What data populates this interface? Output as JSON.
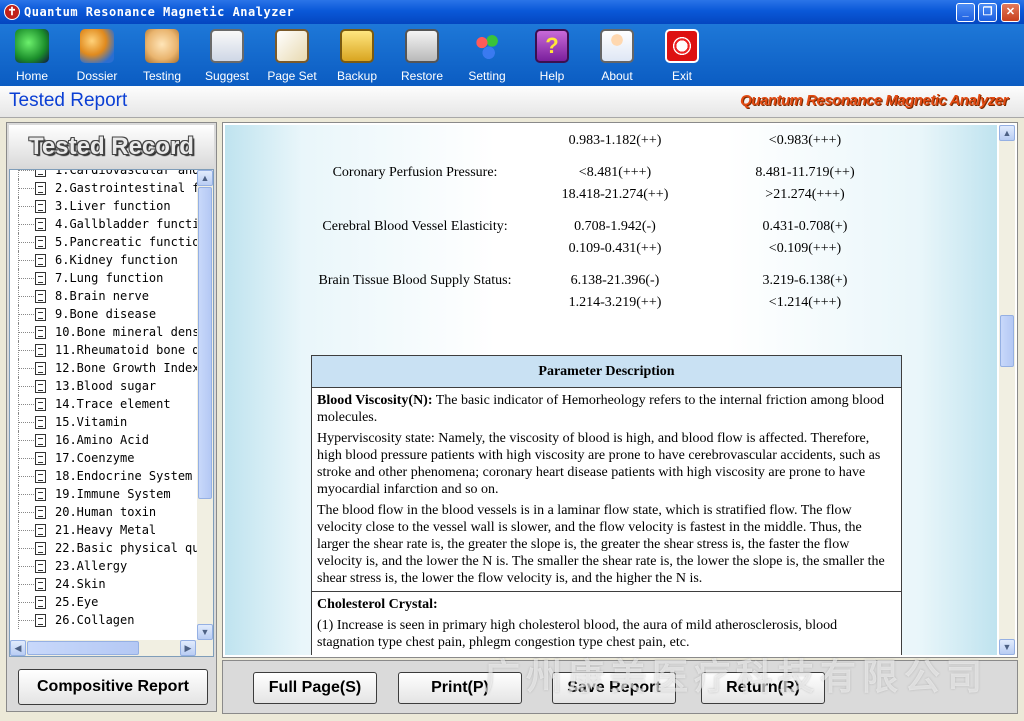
{
  "window": {
    "title": "Quantum Resonance Magnetic Analyzer"
  },
  "toolbar": [
    {
      "label": "Home",
      "icon": "home-icon"
    },
    {
      "label": "Dossier",
      "icon": "users-icon"
    },
    {
      "label": "Testing",
      "icon": "hand-icon"
    },
    {
      "label": "Suggest",
      "icon": "clipboard-icon"
    },
    {
      "label": "Page Set",
      "icon": "page-icon"
    },
    {
      "label": "Backup",
      "icon": "backup-icon"
    },
    {
      "label": "Restore",
      "icon": "restore-icon"
    },
    {
      "label": "Setting",
      "icon": "gears-icon"
    },
    {
      "label": "Help",
      "icon": "help-icon"
    },
    {
      "label": "About",
      "icon": "about-icon"
    },
    {
      "label": "Exit",
      "icon": "power-icon"
    }
  ],
  "header": {
    "title": "Tested Report",
    "brand": "Quantum Resonance Magnetic Analyzer"
  },
  "sidebar": {
    "title": "Tested Record",
    "items": [
      "1.Cardiovascular and",
      "2.Gastrointestinal f",
      "3.Liver function",
      "4.Gallbladder functi",
      "5.Pancreatic functio",
      "6.Kidney function",
      "7.Lung function",
      "8.Brain nerve",
      "9.Bone disease",
      "10.Bone mineral dens",
      "11.Rheumatoid bone d",
      "12.Bone Growth Index",
      "13.Blood sugar",
      "14.Trace element",
      "15.Vitamin",
      "16.Amino Acid",
      "17.Coenzyme",
      "18.Endocrine System",
      "19.Immune System",
      "20.Human toxin",
      "21.Heavy Metal",
      "22.Basic physical qu",
      "23.Allergy",
      "24.Skin",
      "25.Eye",
      "26.Collagen"
    ],
    "button": "Compositive Report"
  },
  "report": {
    "rows": [
      {
        "name": "",
        "a": "0.983-1.182(++)",
        "b": "<0.983(+++)"
      },
      {
        "name": "Coronary Perfusion Pressure:",
        "a": "<8.481(+++)",
        "b": "8.481-11.719(++)"
      },
      {
        "name": "",
        "a": "18.418-21.274(++)",
        "b": ">21.274(+++)"
      },
      {
        "name": "Cerebral Blood Vessel Elasticity:",
        "a": "0.708-1.942(-)",
        "b": "0.431-0.708(+)"
      },
      {
        "name": "",
        "a": "0.109-0.431(++)",
        "b": "<0.109(+++)"
      },
      {
        "name": "Brain Tissue Blood Supply Status:",
        "a": "6.138-21.396(-)",
        "b": "3.219-6.138(+)"
      },
      {
        "name": "",
        "a": "1.214-3.219(++)",
        "b": "<1.214(+++)"
      }
    ],
    "description": {
      "header": "Parameter Description",
      "bv_title": "Blood Viscosity(N):",
      "bv_p1": "The basic indicator of Hemorheology refers to the internal friction among blood molecules.",
      "bv_p2": "Hyperviscosity state: Namely, the viscosity of blood is high, and blood flow is affected. Therefore, high blood pressure patients with high viscosity are prone to have cerebrovascular accidents, such as stroke and other phenomena; coronary heart disease patients with high viscosity are prone to have myocardial infarction and so on.",
      "bv_p3": "The blood flow in the blood vessels is in a laminar flow state, which is stratified flow. The flow velocity close to the vessel wall is slower, and the flow velocity is fastest in the middle. Thus, the larger the shear rate is, the greater the slope is, the greater the shear stress is, the faster the flow velocity is, and the lower the N is. The smaller the shear rate is, the lower the slope is, the smaller the shear stress is, the lower the flow velocity is, and the higher the N is.",
      "cc_title": "Cholesterol Crystal:",
      "cc_p1": "(1) Increase is seen in primary high cholesterol blood, the aura of mild atherosclerosis, blood stagnation type chest pain, phlegm congestion type chest pain, etc."
    }
  },
  "bottom": {
    "full_page": "Full Page(S)",
    "print": "Print(P)",
    "save": "Save Report",
    "return": "Return(R)"
  },
  "watermark": "广州康美医疗科技有限公司"
}
